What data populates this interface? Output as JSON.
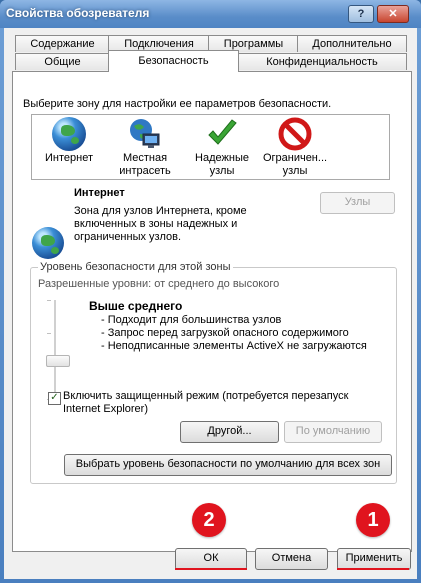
{
  "window": {
    "title": "Свойства обозревателя",
    "help_label": "?",
    "close_label": "✕"
  },
  "tabs_row1": [
    "Содержание",
    "Подключения",
    "Программы",
    "Дополнительно"
  ],
  "tabs_row2": [
    "Общие",
    "Безопасность",
    "Конфиденциальность"
  ],
  "security": {
    "zone_instruction": "Выберите зону для настройки ее параметров безопасности.",
    "zones": [
      {
        "label": "Интернет",
        "icon": "globe-icon"
      },
      {
        "label": "Местная интрасеть",
        "icon": "intranet-icon"
      },
      {
        "label": "Надежные узлы",
        "icon": "checkmark-icon"
      },
      {
        "label": "Ограничен... узлы",
        "icon": "restricted-icon"
      }
    ],
    "selected_zone": {
      "title": "Интернет",
      "description": "Зона для узлов Интернета, кроме включенных в зоны надежных и ограниченных узлов.",
      "sites_button": "Узлы"
    },
    "level_group": {
      "title": "Уровень безопасности для этой зоны",
      "allowed_levels": "Разрешенные уровни: от среднего до высокого",
      "level_name": "Выше среднего",
      "level_items": [
        "- Подходит для большинства узлов",
        "- Запрос перед загрузкой опасного содержимого",
        "- Неподписанные элементы ActiveX не загружаются"
      ],
      "protected_mode_checkbox": "Включить защищенный режим (потребуется перезапуск Internet Explorer)",
      "protected_mode_checked": true,
      "other_button": "Другой...",
      "default_button": "По умолчанию"
    },
    "reset_all_button": "Выбрать уровень безопасности по умолчанию для всех зон"
  },
  "footer": {
    "ok": "ОК",
    "cancel": "Отмена",
    "apply": "Применить"
  },
  "annotations": {
    "badge_1": "1",
    "badge_2": "2",
    "color": "#e0141e"
  }
}
